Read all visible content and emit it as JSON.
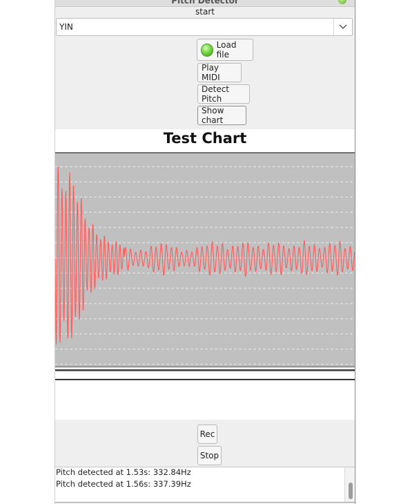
{
  "window": {
    "title": "Pitch Detector"
  },
  "input": {
    "label": "start"
  },
  "algorithm_select": {
    "value": "YIN"
  },
  "buttons": {
    "load_file": "Load file",
    "play_midi": "Play MIDI",
    "detect_pitch": "Detect Pitch",
    "show_chart": "Show chart",
    "rec": "Rec",
    "stop": "Stop"
  },
  "chart_data": {
    "type": "line",
    "title": "Test Chart",
    "xlabel": "",
    "ylabel": "",
    "grid": true,
    "series_color": "#ff5a5a",
    "background_color": "#c0c0c0"
  },
  "log": {
    "lines": [
      "Pitch detected at 1.53s: 332.84Hz",
      "Pitch detected at 1.56s: 337.39Hz"
    ]
  }
}
